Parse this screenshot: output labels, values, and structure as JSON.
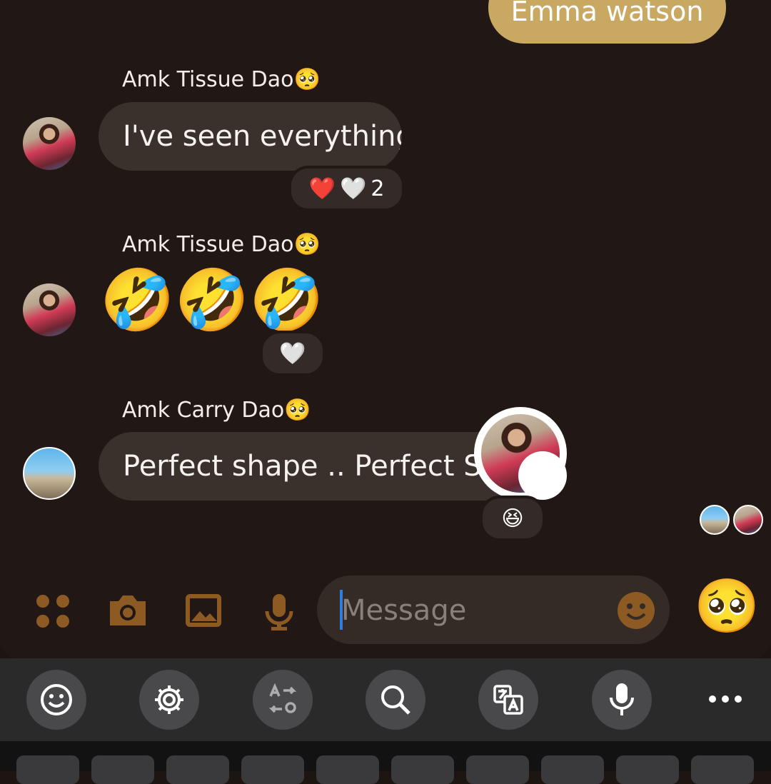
{
  "chat": {
    "outgoing_partial": "Emma watson",
    "messages": [
      {
        "sender": "Amk Tissue Dao",
        "sender_emoji": "🥺",
        "text": "I've seen everything",
        "reactions": [
          "❤️",
          "🤍"
        ],
        "reaction_count": "2"
      },
      {
        "sender": "Amk Tissue Dao",
        "sender_emoji": "🥺",
        "emojis": [
          "🤣",
          "🤣",
          "🤣"
        ],
        "reactions": [
          "🤍"
        ]
      },
      {
        "sender": "Amk Carry Dao",
        "sender_emoji": "🥺",
        "text": "Perfect shape .. Perfect Size",
        "reactions": [
          "😆"
        ],
        "reactor_badge": "😆"
      }
    ]
  },
  "composer": {
    "placeholder": "Message",
    "quick_emoji": "🥺",
    "icons": [
      "apps-icon",
      "camera-icon",
      "gallery-icon",
      "mic-icon",
      "emoji-icon"
    ]
  },
  "keyboard_toolbar": {
    "icons": [
      "emoji-icon",
      "settings-icon",
      "text-swap-icon",
      "search-icon",
      "translate-icon",
      "mic-icon",
      "more-icon"
    ]
  },
  "colors": {
    "background": "#211815",
    "outgoing_bubble": "#c9a862",
    "incoming_bubble": "#3a302c",
    "accent_icons": "#8c5a22",
    "keyboard_bar": "#2a2a2b"
  }
}
